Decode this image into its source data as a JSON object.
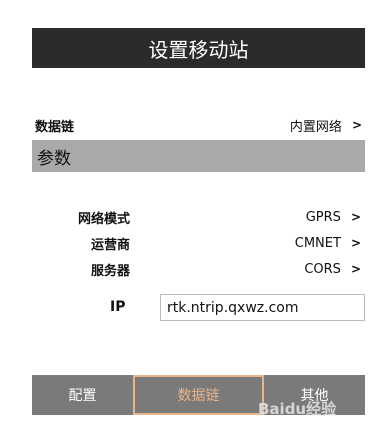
{
  "title": "设置移动站",
  "datalink_row": {
    "label": "数据链",
    "value": "内置网络",
    "chevron": ">"
  },
  "section": {
    "title": "参数"
  },
  "params": [
    {
      "label": "网络模式",
      "value": "GPRS",
      "chevron": ">"
    },
    {
      "label": "运营商",
      "value": "CMNET",
      "chevron": ">"
    },
    {
      "label": "服务器",
      "value": "CORS",
      "chevron": ">"
    }
  ],
  "ip": {
    "label": "IP",
    "value": "rtk.ntrip.qxwz.com"
  },
  "tabs": [
    {
      "label": "配置"
    },
    {
      "label": "数据链"
    },
    {
      "label": "其他"
    }
  ],
  "watermark": {
    "text": "Baidu经验"
  },
  "colors": {
    "header": "#2b2b2b",
    "section": "#a9a9a9",
    "tabbar": "#7a7a7a",
    "active_tab_border": "#e8b489"
  }
}
